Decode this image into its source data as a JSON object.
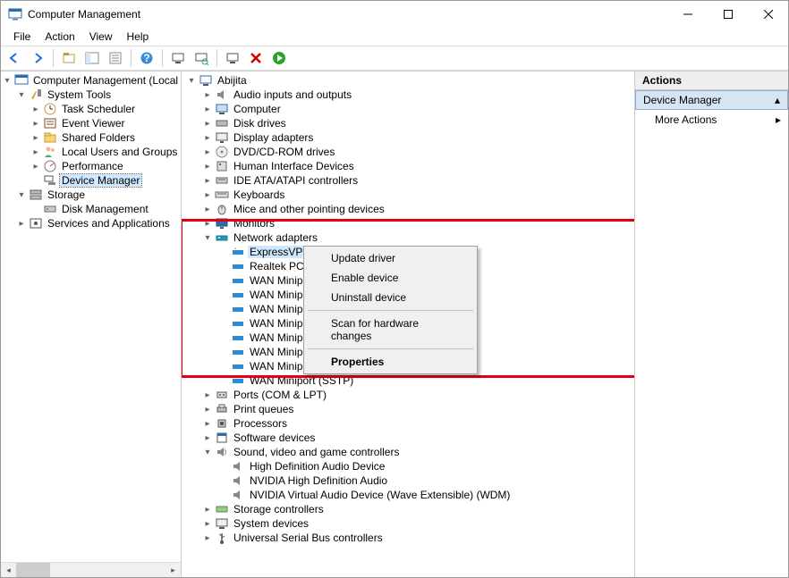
{
  "title": "Computer Management",
  "menus": [
    "File",
    "Action",
    "View",
    "Help"
  ],
  "left_tree": {
    "root": "Computer Management (Local",
    "system_tools": "System Tools",
    "task_scheduler": "Task Scheduler",
    "event_viewer": "Event Viewer",
    "shared_folders": "Shared Folders",
    "local_users": "Local Users and Groups",
    "performance": "Performance",
    "device_manager": "Device Manager",
    "storage": "Storage",
    "disk_management": "Disk Management",
    "services_apps": "Services and Applications"
  },
  "device_root": "Abijita",
  "categories": {
    "audio": "Audio inputs and outputs",
    "computer": "Computer",
    "disk": "Disk drives",
    "display": "Display adapters",
    "dvd": "DVD/CD-ROM drives",
    "hid": "Human Interface Devices",
    "ide": "IDE ATA/ATAPI controllers",
    "keyboards": "Keyboards",
    "mice": "Mice and other pointing devices",
    "monitors": "Monitors",
    "network": "Network adapters",
    "ports": "Ports (COM & LPT)",
    "print": "Print queues",
    "processors": "Processors",
    "software": "Software devices",
    "sound": "Sound, video and game controllers",
    "storage_ctrl": "Storage controllers",
    "system": "System devices",
    "usb": "Universal Serial Bus controllers"
  },
  "network_children": [
    "ExpressVPN TAP Adapter",
    "Realtek PCIe GbE",
    "WAN Miniport (I",
    "WAN Miniport (I",
    "WAN Miniport (I",
    "WAN Miniport (I",
    "WAN Miniport (I",
    "WAN Miniport (L",
    "WAN Miniport (PPTP)",
    "WAN Miniport (SSTP)"
  ],
  "sound_children": [
    "High Definition Audio Device",
    "NVIDIA High Definition Audio",
    "NVIDIA Virtual Audio Device (Wave Extensible) (WDM)"
  ],
  "context_menu": {
    "update": "Update driver",
    "enable": "Enable device",
    "uninstall": "Uninstall device",
    "scan": "Scan for hardware changes",
    "properties": "Properties"
  },
  "actions": {
    "header": "Actions",
    "section": "Device Manager",
    "more": "More Actions"
  }
}
